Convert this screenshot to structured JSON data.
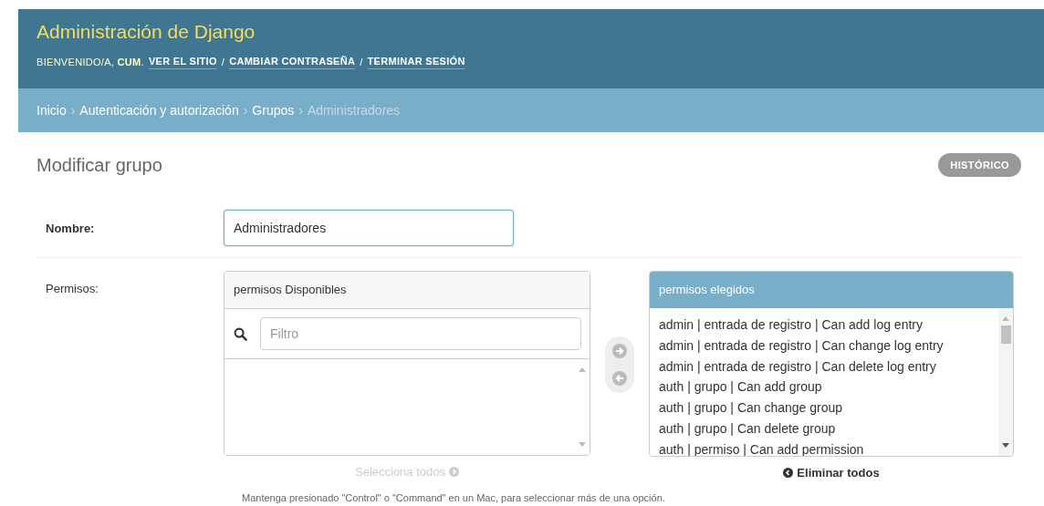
{
  "header": {
    "site_name": "Administración de Django",
    "user_tools": [
      {
        "kind": "text",
        "text": "BIENVENIDO/A, **CUM**."
      },
      {
        "kind": "link",
        "text": "VER EL SITIO"
      },
      {
        "kind": "separator",
        "text": "/"
      },
      {
        "kind": "link",
        "text": "CAMBIAR CONTRASEÑA"
      },
      {
        "kind": "separator",
        "text": "/"
      },
      {
        "kind": "link",
        "text": "TERMINAR SESIÓN"
      }
    ]
  },
  "breadcrumbs": [
    {
      "kind": "link",
      "text": "Inicio"
    },
    {
      "kind": "separator",
      "text": "›"
    },
    {
      "kind": "link",
      "text": "Autenticación y autorización"
    },
    {
      "kind": "separator",
      "text": "›"
    },
    {
      "kind": "link",
      "text": "Grupos"
    },
    {
      "kind": "separator",
      "text": "›"
    },
    {
      "kind": "current",
      "text": "Administradores"
    }
  ],
  "page_title": "Modificar grupo",
  "history_button": "HISTÓRICO",
  "name_field": {
    "label": "Nombre:",
    "value": "Administradores"
  },
  "permissions": {
    "label": "Permisos:",
    "available": {
      "title": "permisos Disponibles",
      "filter_placeholder": "Filtro",
      "choose_all": {
        "text": "Selecciona todos",
        "disabled": true
      }
    },
    "add_arrow": {
      "disabled": true
    },
    "remove_arrow": {
      "disabled": true
    },
    "chosen": {
      "title": "permisos elegidos",
      "items": [
        "admin | entrada de registro | Can add log entry",
        "admin | entrada de registro | Can change log entry",
        "admin | entrada de registro | Can delete log entry",
        "auth | grupo | Can add group",
        "auth | grupo | Can change group",
        "auth | grupo | Can delete group",
        "auth | permiso | Can add permission"
      ],
      "remove_all": {
        "text": "Eliminar todos",
        "disabled": false
      }
    },
    "help": "Mantenga presionado \"Control\" o \"Command\" en un Mac, para seleccionar más de una opción."
  }
}
